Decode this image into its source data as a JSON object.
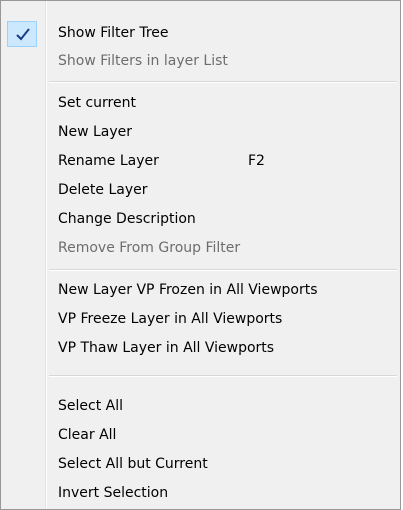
{
  "menu": {
    "group1": [
      {
        "label": "Show Filter Tree",
        "checked": true,
        "disabled": false
      },
      {
        "label": "Show Filters in layer List",
        "checked": false,
        "disabled": true
      }
    ],
    "group2": [
      {
        "label": "Set current",
        "disabled": false
      },
      {
        "label": "New Layer",
        "disabled": false
      },
      {
        "label": "Rename Layer",
        "shortcut": "F2",
        "disabled": false
      },
      {
        "label": "Delete Layer",
        "disabled": false
      },
      {
        "label": "Change Description",
        "disabled": false
      },
      {
        "label": "Remove From Group Filter",
        "disabled": true
      }
    ],
    "group3": [
      {
        "label": "New Layer VP Frozen in All Viewports",
        "disabled": false
      },
      {
        "label": "VP Freeze Layer in All Viewports",
        "disabled": false
      },
      {
        "label": "VP Thaw Layer in All Viewports",
        "disabled": false
      }
    ],
    "group4": [
      {
        "label": "Select All",
        "disabled": false
      },
      {
        "label": "Clear All",
        "disabled": false
      },
      {
        "label": "Select All but Current",
        "disabled": false
      },
      {
        "label": "Invert Selection",
        "disabled": false
      }
    ]
  },
  "icons": {
    "check": "checkmark-icon"
  },
  "colors": {
    "menu_background": "#f0f0f0",
    "check_highlight": "#cce8ff",
    "disabled_text": "#6d6d6d",
    "check_color": "#1a3a8a"
  }
}
